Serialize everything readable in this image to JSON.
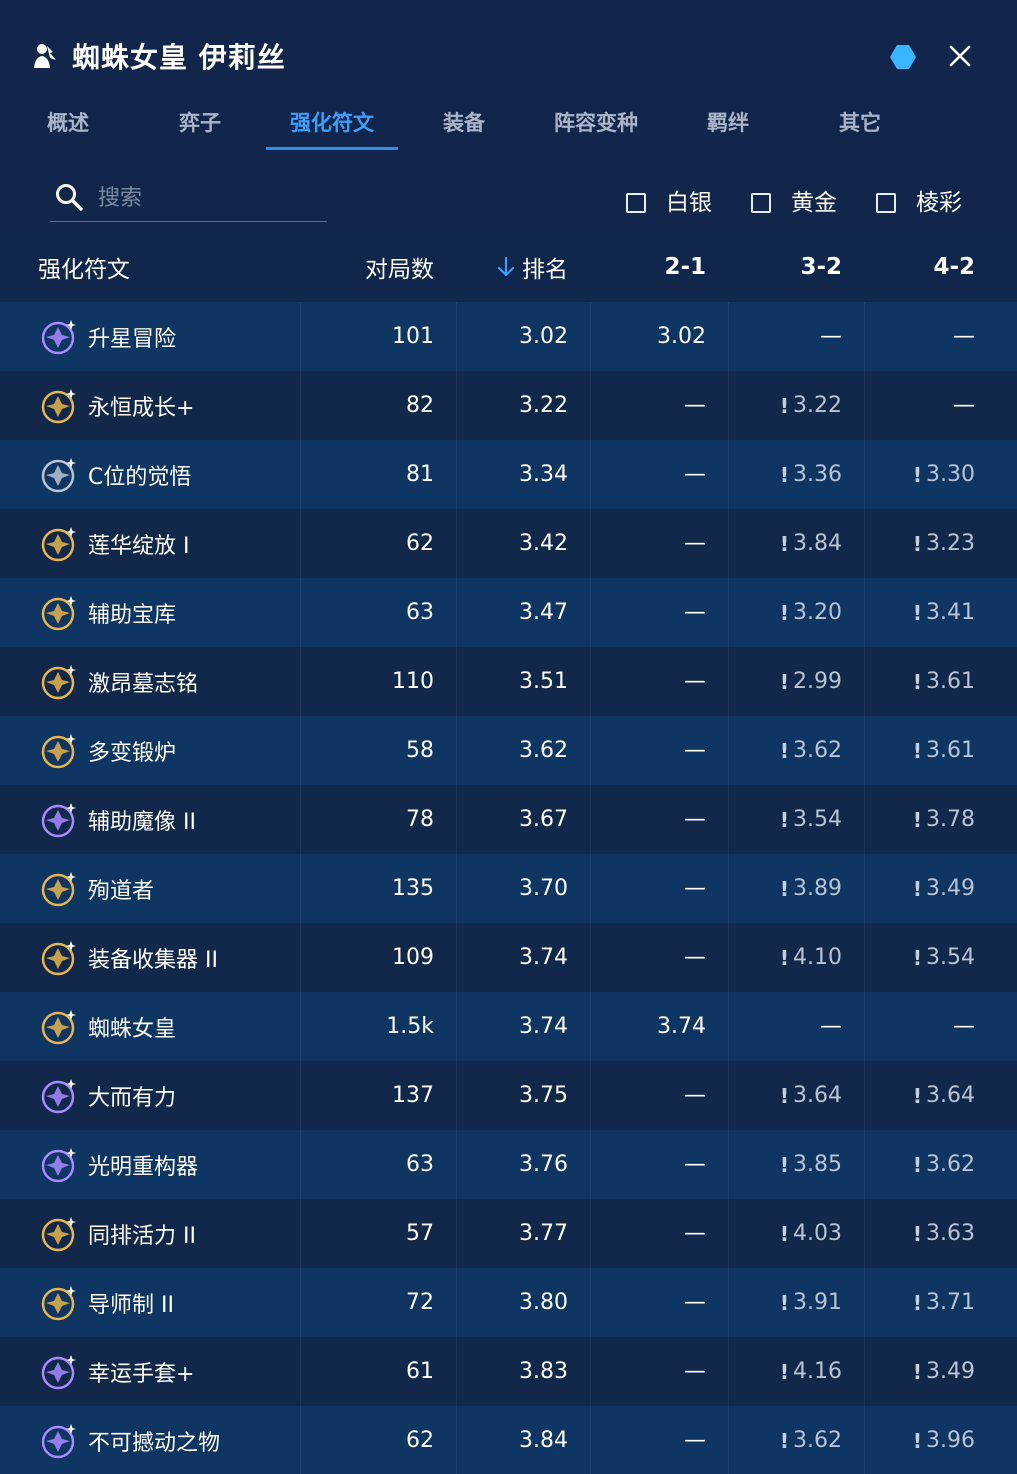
{
  "header": {
    "title": "蜘蛛女皇 伊莉丝",
    "title_icon": "champion-silhouette-icon",
    "hex_color": "#38b6ff",
    "close_icon": "close-icon"
  },
  "tabs": [
    {
      "label": "概述"
    },
    {
      "label": "弈子"
    },
    {
      "label": "强化符文",
      "active": true
    },
    {
      "label": "装备"
    },
    {
      "label": "阵容变种"
    },
    {
      "label": "羁绊"
    },
    {
      "label": "其它"
    }
  ],
  "search": {
    "placeholder": "搜索",
    "value": ""
  },
  "filters": [
    {
      "label": "白银",
      "checked": false
    },
    {
      "label": "黄金",
      "checked": false
    },
    {
      "label": "棱彩",
      "checked": false
    }
  ],
  "table": {
    "columns": [
      "强化符文",
      "对局数",
      "排名",
      "2-1",
      "3-2",
      "4-2"
    ],
    "sort_column": "排名",
    "rows": [
      {
        "name": "升星冒险",
        "icon": "star-adventure-icon",
        "tier": "prismatic",
        "games": "101",
        "rank": "3.02",
        "s21": "3.02",
        "s32": "—",
        "s42": "—"
      },
      {
        "name": "永恒成长+",
        "icon": "eternal-growth-icon",
        "tier": "gold",
        "games": "82",
        "rank": "3.22",
        "s21": "—",
        "s32": "3.22",
        "s42": "—"
      },
      {
        "name": "C位的觉悟",
        "icon": "carry-resolve-icon",
        "tier": "silver",
        "games": "81",
        "rank": "3.34",
        "s21": "—",
        "s32": "3.36",
        "s42": "3.30"
      },
      {
        "name": "莲华绽放 I",
        "icon": "lotus-bloom-icon",
        "tier": "gold",
        "games": "62",
        "rank": "3.42",
        "s21": "—",
        "s32": "3.84",
        "s42": "3.23"
      },
      {
        "name": "辅助宝库",
        "icon": "support-cache-icon",
        "tier": "gold",
        "games": "63",
        "rank": "3.47",
        "s21": "—",
        "s32": "3.20",
        "s42": "3.41"
      },
      {
        "name": "激昂墓志铭",
        "icon": "epitaph-icon",
        "tier": "gold",
        "games": "110",
        "rank": "3.51",
        "s21": "—",
        "s32": "2.99",
        "s42": "3.61"
      },
      {
        "name": "多变锻炉",
        "icon": "variable-forge-icon",
        "tier": "gold",
        "games": "58",
        "rank": "3.62",
        "s21": "—",
        "s32": "3.62",
        "s42": "3.61"
      },
      {
        "name": "辅助魔像 II",
        "icon": "support-golem-icon",
        "tier": "prismatic",
        "games": "78",
        "rank": "3.67",
        "s21": "—",
        "s32": "3.54",
        "s42": "3.78"
      },
      {
        "name": "殉道者",
        "icon": "martyr-icon",
        "tier": "gold",
        "games": "135",
        "rank": "3.70",
        "s21": "—",
        "s32": "3.89",
        "s42": "3.49"
      },
      {
        "name": "装备收集器 II",
        "icon": "item-collector-icon",
        "tier": "gold",
        "games": "109",
        "rank": "3.74",
        "s21": "—",
        "s32": "4.10",
        "s42": "3.54"
      },
      {
        "name": "蜘蛛女皇",
        "icon": "spider-queen-icon",
        "tier": "gold",
        "games": "1.5k",
        "rank": "3.74",
        "s21": "3.74",
        "s32": "—",
        "s42": "—"
      },
      {
        "name": "大而有力",
        "icon": "big-strong-icon",
        "tier": "prismatic",
        "games": "137",
        "rank": "3.75",
        "s21": "—",
        "s32": "3.64",
        "s42": "3.64"
      },
      {
        "name": "光明重构器",
        "icon": "radiant-refactor-icon",
        "tier": "prismatic",
        "games": "63",
        "rank": "3.76",
        "s21": "—",
        "s32": "3.85",
        "s42": "3.62"
      },
      {
        "name": "同排活力 II",
        "icon": "rowwise-vigor-icon",
        "tier": "gold",
        "games": "57",
        "rank": "3.77",
        "s21": "—",
        "s32": "4.03",
        "s42": "3.63"
      },
      {
        "name": "导师制 II",
        "icon": "mentorship-icon",
        "tier": "gold",
        "games": "72",
        "rank": "3.80",
        "s21": "—",
        "s32": "3.91",
        "s42": "3.71"
      },
      {
        "name": "幸运手套+",
        "icon": "lucky-gloves-icon",
        "tier": "prismatic",
        "games": "61",
        "rank": "3.83",
        "s21": "—",
        "s32": "4.16",
        "s42": "3.49"
      },
      {
        "name": "不可撼动之物",
        "icon": "immovable-object-icon",
        "tier": "prismatic",
        "games": "62",
        "rank": "3.84",
        "s21": "—",
        "s32": "3.62",
        "s42": "3.96"
      }
    ]
  },
  "colors": {
    "accent": "#3aa0ff",
    "gold": "#e8b54a",
    "prismatic": "#a88bff",
    "silver": "#b8c4d6"
  }
}
